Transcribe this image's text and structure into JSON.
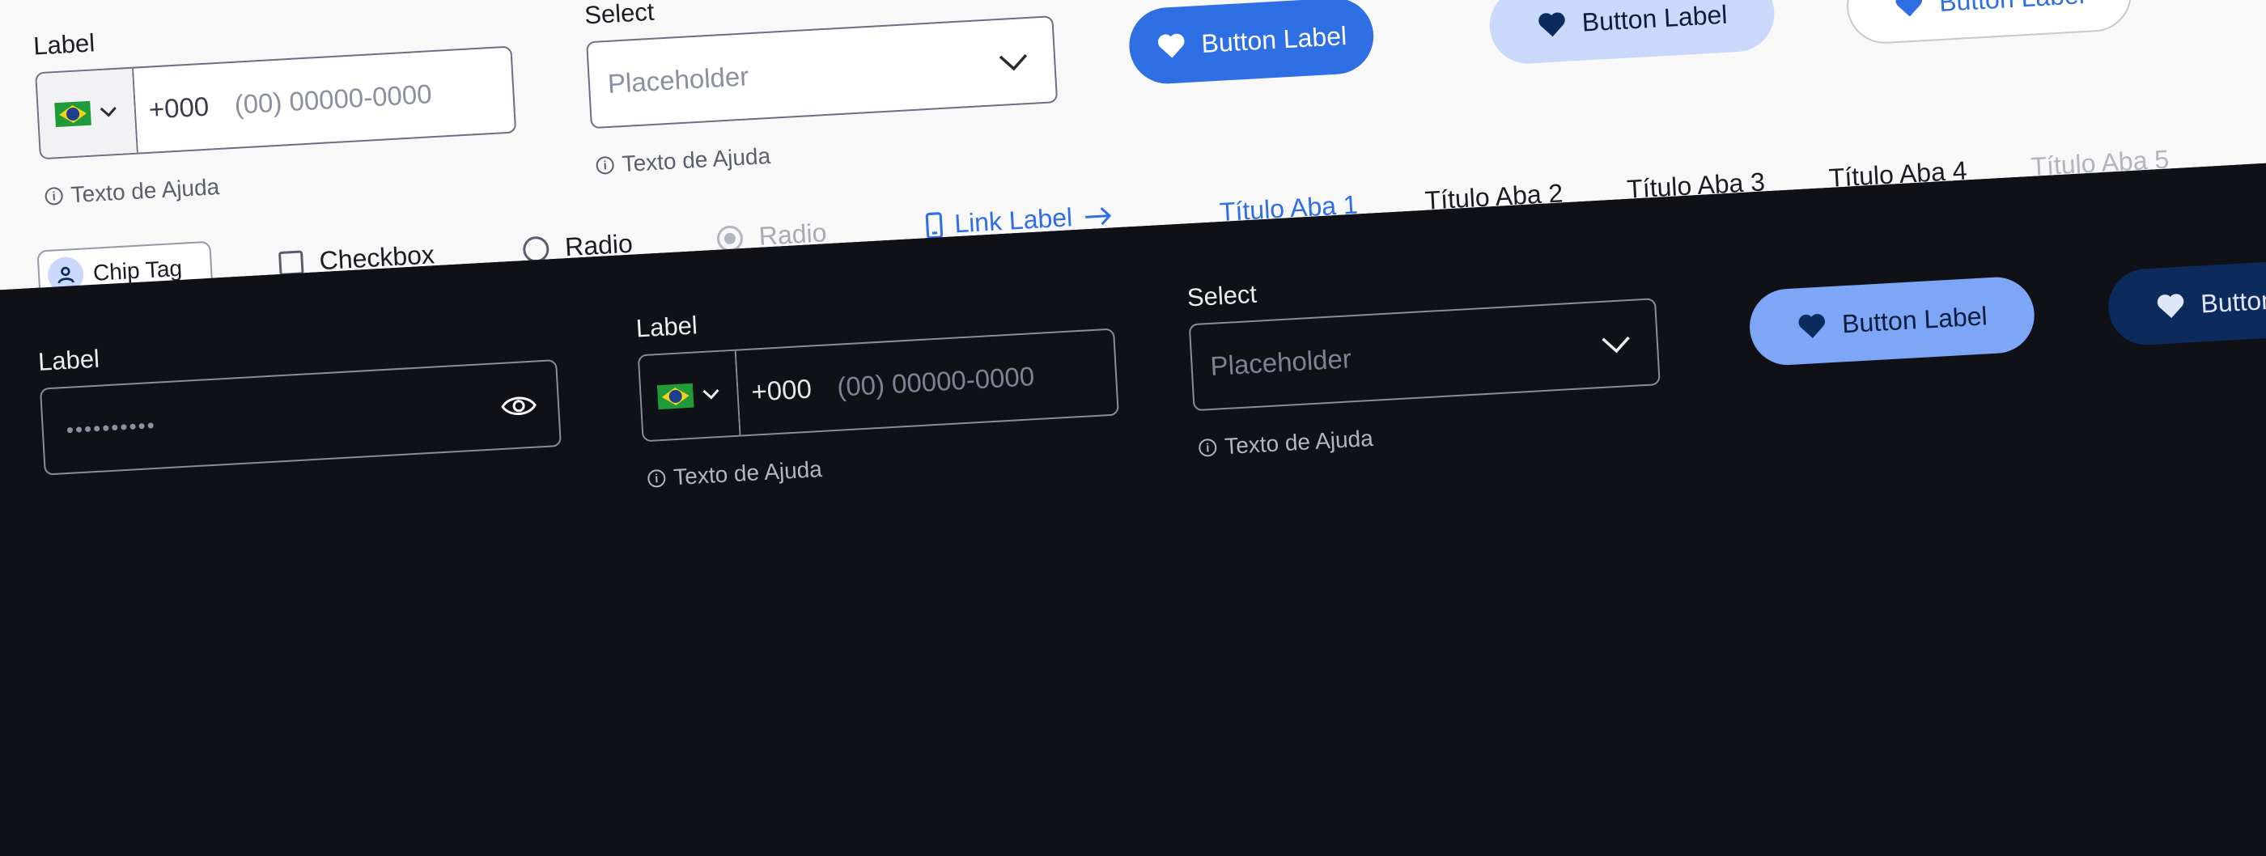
{
  "light": {
    "phone": {
      "label": "Label",
      "ddi": "+000",
      "placeholder": "(00) 00000-0000",
      "help": "Texto de Ajuda"
    },
    "select": {
      "label": "Select",
      "placeholder": "Placeholder",
      "help": "Texto de Ajuda"
    },
    "buttons": [
      {
        "label": "Button Label",
        "variant": "primary"
      },
      {
        "label": "Button Label",
        "variant": "secondary"
      },
      {
        "label": "Button Label",
        "variant": "outline"
      }
    ],
    "chip": {
      "label": "Chip Tag"
    },
    "checkbox": {
      "label": "Checkbox"
    },
    "radio": {
      "label": "Radio"
    },
    "radio_disabled": {
      "label": "Radio"
    },
    "link": {
      "label": "Link Label"
    },
    "tabs": [
      "Título Aba 1",
      "Título Aba 2",
      "Título Aba 3",
      "Título Aba 4",
      "Título Aba 5"
    ]
  },
  "dark": {
    "password": {
      "label": "Label",
      "value": "••••••••••"
    },
    "phone": {
      "label": "Label",
      "ddi": "+000",
      "placeholder": "(00) 00000-0000",
      "help": "Texto de Ajuda"
    },
    "select": {
      "label": "Select",
      "placeholder": "Placeholder",
      "help": "Texto de Ajuda"
    },
    "buttons": [
      {
        "label": "Button Label",
        "variant": "primary-light"
      },
      {
        "label": "Button Label",
        "variant": "primary-dark"
      }
    ]
  },
  "colors": {
    "primary": "#2f6fe4",
    "secondary": "#c9d8fb",
    "navy": "#0d2a5c",
    "tab_active": "#2f6fe4",
    "tab_disabled": "#b2b5be"
  }
}
